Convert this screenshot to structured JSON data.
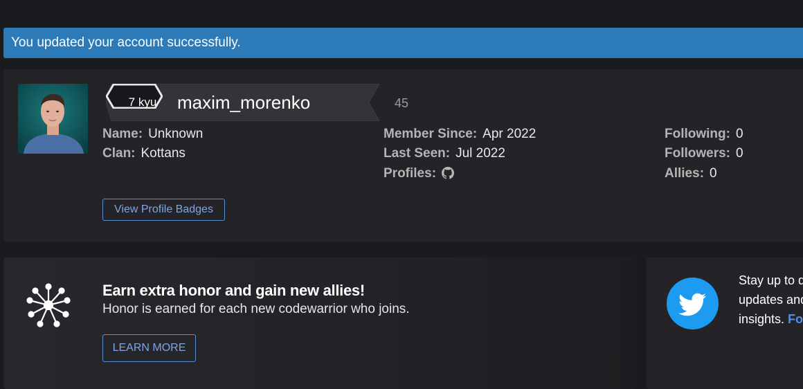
{
  "flash": {
    "message": "You updated your account successfully."
  },
  "profile": {
    "rank": "7 kyu",
    "username": "maxim_morenko",
    "honor": "45",
    "name_label": "Name:",
    "name_value": "Unknown",
    "clan_label": "Clan:",
    "clan_value": "Kottans",
    "member_since_label": "Member Since:",
    "member_since_value": "Apr 2022",
    "last_seen_label": "Last Seen:",
    "last_seen_value": "Jul 2022",
    "profiles_label": "Profiles:",
    "profiles_icons": [
      "github-icon"
    ],
    "following_label": "Following:",
    "following_value": "0",
    "followers_label": "Followers:",
    "followers_value": "0",
    "allies_label": "Allies:",
    "allies_value": "0",
    "badges_button": "View Profile Badges"
  },
  "invite": {
    "icon": "network-hub-icon",
    "title": "Earn extra honor and gain new allies!",
    "subtitle": "Honor is earned for each new codewarrior who joins.",
    "button": "LEARN MORE"
  },
  "twitter": {
    "icon": "twitter-bird-icon",
    "line1": "Stay up to d",
    "line2": "updates and",
    "line3_text": "insights. ",
    "line3_link": "Fo"
  },
  "colors": {
    "background": "#1a1b1f",
    "card": "#242428",
    "flash": "#2c7ab8",
    "accent_link": "#7fa6e0",
    "twitter_blue": "#1d9bf0"
  }
}
